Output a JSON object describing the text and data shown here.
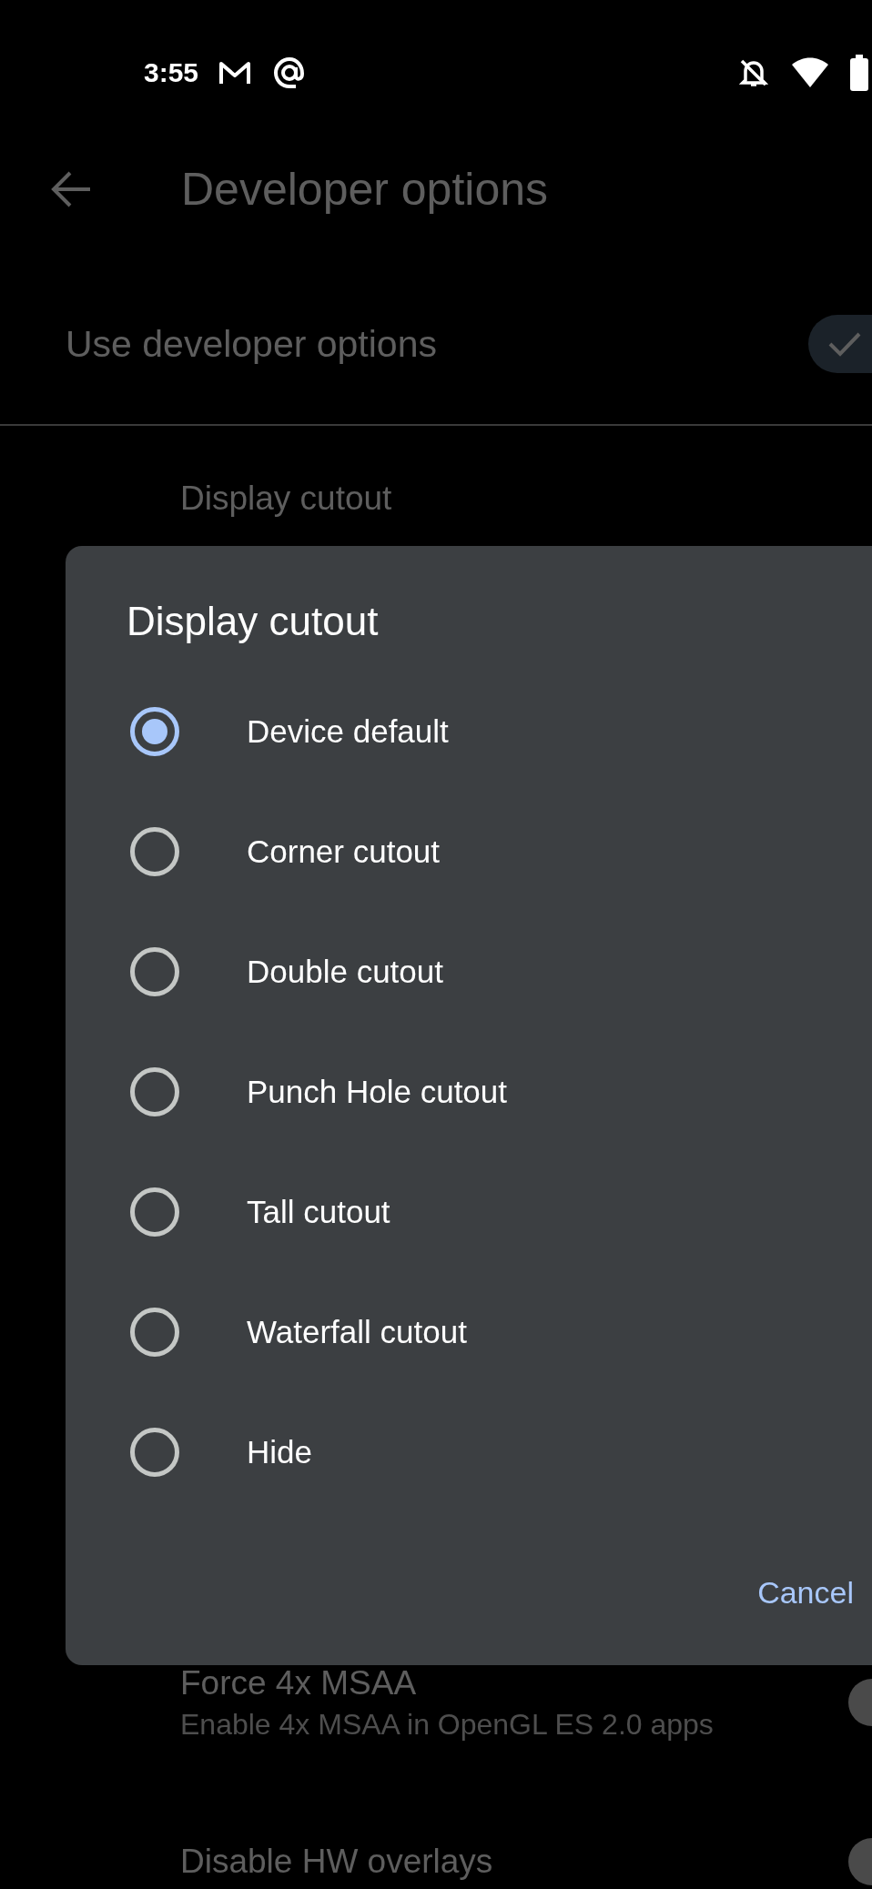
{
  "status_bar": {
    "time": "3:55"
  },
  "app_bar": {
    "title": "Developer options"
  },
  "main_switch": {
    "label": "Use developer options",
    "on": true
  },
  "settings": [
    {
      "title": "Display cutout"
    },
    {
      "title": "Force 4x MSAA",
      "subtitle": "Enable 4x MSAA in OpenGL ES 2.0 apps",
      "on": false
    },
    {
      "title": "Disable HW overlays",
      "on": false
    }
  ],
  "dialog": {
    "title": "Display cutout",
    "options": [
      {
        "label": "Device default",
        "selected": true
      },
      {
        "label": "Corner cutout",
        "selected": false
      },
      {
        "label": "Double cutout",
        "selected": false
      },
      {
        "label": "Punch Hole cutout",
        "selected": false
      },
      {
        "label": "Tall cutout",
        "selected": false
      },
      {
        "label": "Waterfall cutout",
        "selected": false
      },
      {
        "label": "Hide",
        "selected": false
      }
    ],
    "buttons": [
      {
        "label": "Cancel"
      }
    ]
  }
}
